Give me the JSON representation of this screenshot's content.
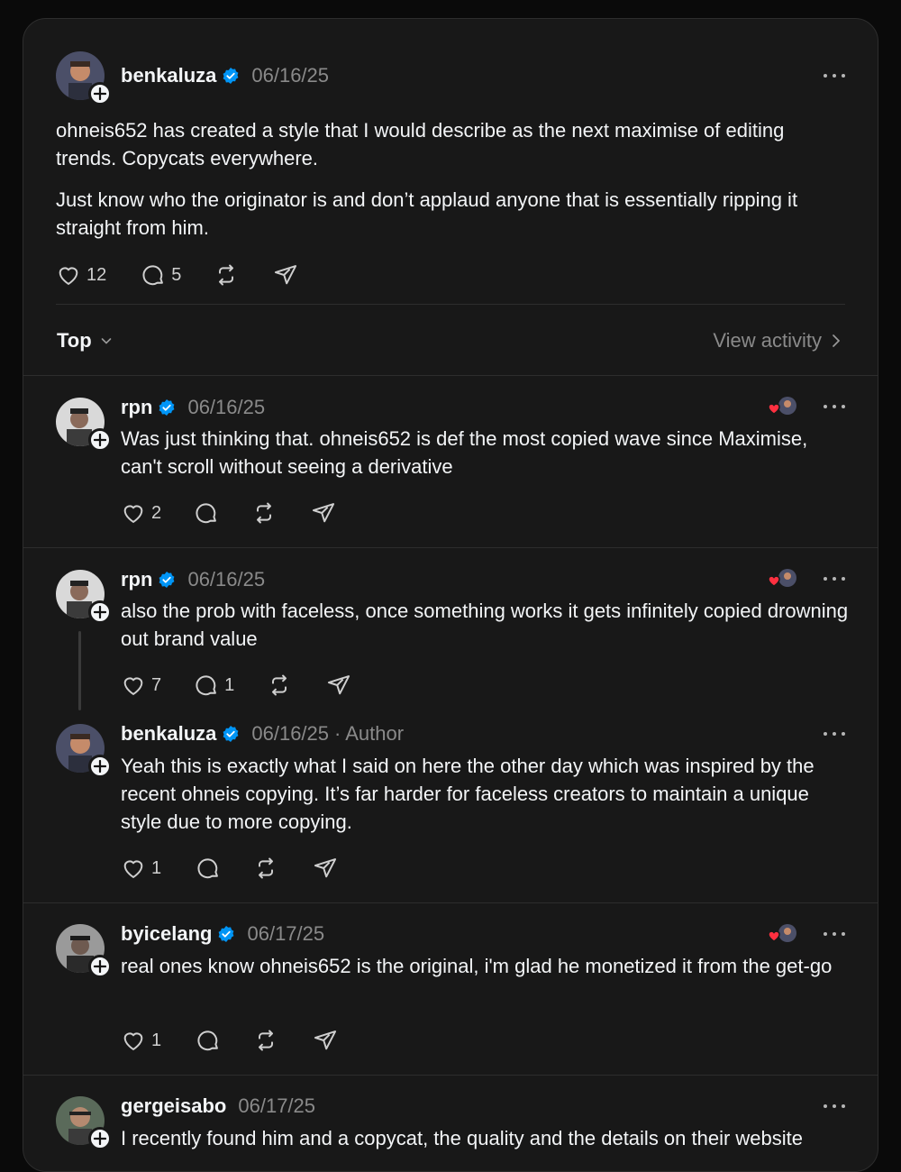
{
  "post": {
    "username": "benkaluza",
    "date": "06/16/25",
    "paragraph1": "ohneis652 has created a style that I would describe as the next maximise of editing trends. Copycats everywhere.",
    "paragraph2": "Just know who the originator is and don’t applaud anyone that is essentially ripping it straight from him.",
    "likes": "12",
    "replies": "5"
  },
  "sort": {
    "label": "Top",
    "view_activity": "View activity"
  },
  "replies": [
    {
      "username": "rpn",
      "date": "06/16/25",
      "text": "Was just thinking that. ohneis652 is def the most copied wave since Maximise, can't scroll without seeing a derivative",
      "likes": "2",
      "replies": ""
    },
    {
      "username": "rpn",
      "date": "06/16/25",
      "text": "also the prob with faceless, once something works it gets infinitely copied drowning out brand value",
      "likes": "7",
      "replies": "1"
    },
    {
      "username": "benkaluza",
      "date": "06/16/25",
      "author_label": "· Author",
      "text": "Yeah this is exactly what I said on here the other day which was inspired by the recent ohneis copying. It’s far harder for faceless creators to maintain a unique style due to more copying.",
      "likes": "1",
      "replies": ""
    },
    {
      "username": "byicelang",
      "date": "06/17/25",
      "text": "real ones know ohneis652 is the original, i'm glad he monetized it from the get-go",
      "likes": "1",
      "replies": ""
    },
    {
      "username": "gergeisabo",
      "date": "06/17/25",
      "text": "I recently found him and a copycat, the quality and the details on their website"
    }
  ],
  "colors": {
    "verified": "#0095f6",
    "like_heart": "#ff3040",
    "background": "#181818"
  }
}
